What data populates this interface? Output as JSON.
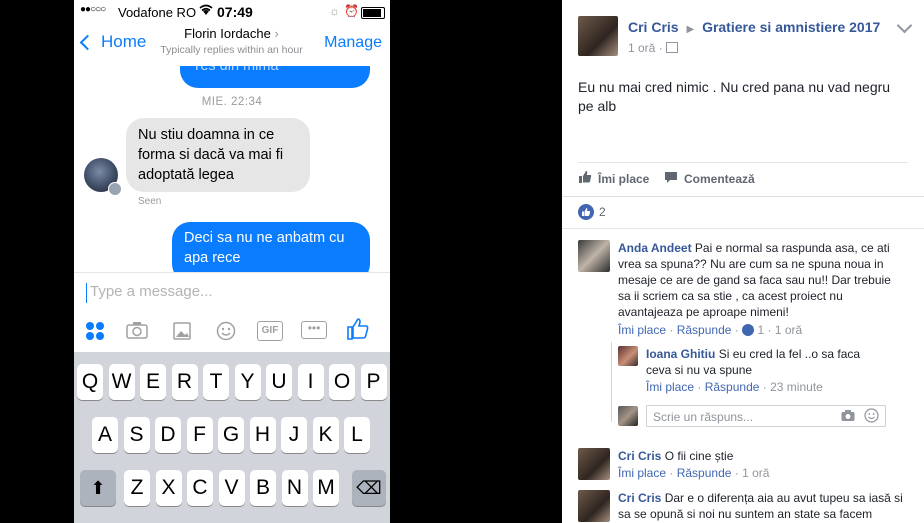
{
  "messenger": {
    "status": {
      "dots": "●●○○○",
      "carrier": "Vodafone RO",
      "time": "07:49"
    },
    "nav": {
      "back_label": "Home",
      "contact_name": "Florin Iordache",
      "subtitle": "Typically replies within an hour",
      "manage_label": "Manage"
    },
    "messages": {
      "partial_out": "Yes din mima",
      "timestamp": "MIE. 22:34",
      "incoming": "Nu stiu doamna in ce forma si dacă va mai fi adoptată legea",
      "seen": "Seen",
      "outgoing": "Deci sa nu ne anbatm cu apa rece"
    },
    "composer": {
      "placeholder": "Type a message...",
      "tools": [
        "apps-icon",
        "camera-icon",
        "gallery-icon",
        "emoji-icon",
        "gif-icon",
        "more-icon",
        "like-icon"
      ],
      "gif_label": "GIF"
    },
    "keyboard": {
      "row1": [
        "Q",
        "W",
        "E",
        "R",
        "T",
        "Y",
        "U",
        "I",
        "O",
        "P"
      ],
      "row2": [
        "A",
        "S",
        "D",
        "F",
        "G",
        "H",
        "J",
        "K",
        "L"
      ],
      "row3": [
        "Z",
        "X",
        "C",
        "V",
        "B",
        "N",
        "M"
      ],
      "shift": "⬆",
      "delete": "⌫"
    }
  },
  "facebook": {
    "post": {
      "author": "Cri Cris",
      "group": "Gratiere si amnistiere 2017",
      "time": "1 oră",
      "text": "Eu nu mai cred nimic . Nu cred pana nu vad negru pe alb",
      "like_label": "Îmi place",
      "comment_label": "Comentează",
      "like_count": "2"
    },
    "comments": [
      {
        "author": "Anda Andeet",
        "text": "Pai e normal sa raspunda asa, ce ati vrea sa spuna?? Nu are cum sa ne spuna noua in mesaje ce are de gand sa faca sau nu!! Dar trebuie sa ii scriem ca sa stie , ca acest proiect nu avantajeaza pe aproape nimeni!",
        "like": "Îmi place",
        "reply": "Răspunde",
        "likes": "1",
        "time": "1 oră"
      },
      {
        "author": "Ioana Ghitiu",
        "text": "Si eu cred la fel ..o sa faca ceva si nu va spune",
        "like": "Îmi place",
        "reply": "Răspunde",
        "time": "23 minute"
      },
      {
        "author": "Cri Cris",
        "text": "O fii cine știe",
        "like": "Îmi place",
        "reply": "Răspunde",
        "time": "1 oră"
      },
      {
        "author": "Cri Cris",
        "text": "Dar e o diferența aia au avut tupeu sa iasă si sa se opună si noi nu suntem an state sa facem"
      }
    ],
    "reply_placeholder": "Scrie un răspuns...",
    "separator": "·"
  }
}
